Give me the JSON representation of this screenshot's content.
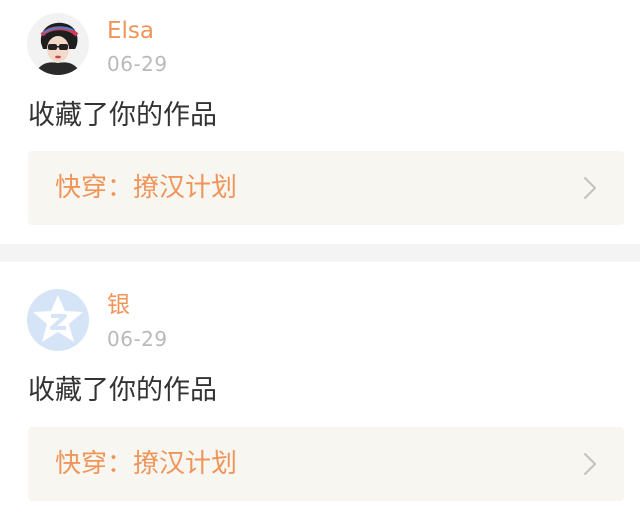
{
  "colors": {
    "accent": "#f0955a",
    "date": "#b9b9b9",
    "link_bg": "#f7f6f0",
    "divider": "#f4f4f4",
    "chevron": "#c2c2c2",
    "default_avatar_bg": "#d5e4f6",
    "default_avatar_fg": "#ffffff"
  },
  "notifications": [
    {
      "username": "Elsa",
      "date": "06-29",
      "action": "收藏了你的作品",
      "work_title": "快穿：撩汉计划",
      "avatar_icon": "user-photo-avatar",
      "chevron_icon": "chevron-right-icon"
    },
    {
      "username": "银",
      "date": "06-29",
      "action": "收藏了你的作品",
      "work_title": "快穿：撩汉计划",
      "avatar_icon": "default-star-avatar",
      "chevron_icon": "chevron-right-icon"
    }
  ]
}
